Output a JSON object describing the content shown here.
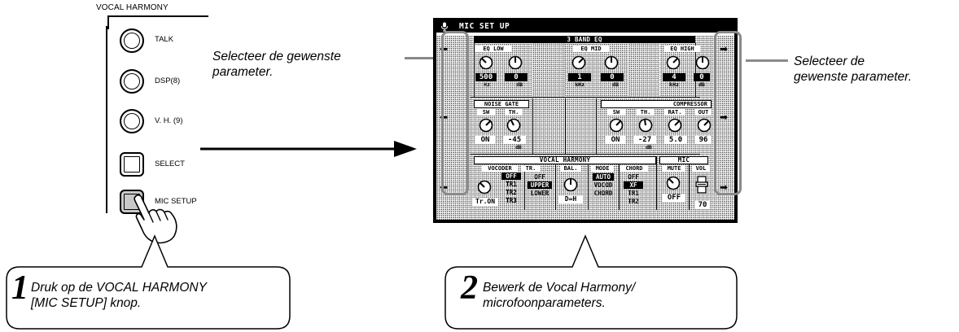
{
  "panel": {
    "title": "VOCAL HARMONY",
    "buttons": [
      {
        "label": "TALK"
      },
      {
        "label": "DSP(8)"
      },
      {
        "label": "V. H. (9)"
      },
      {
        "label": "SELECT"
      },
      {
        "label": "MIC SETUP"
      }
    ]
  },
  "annotations": {
    "left_caption": "Selecteer de gewenste parameter.",
    "left_caption_lines": [
      "Selecteer de gewenste",
      "parameter."
    ],
    "right_caption": "Selecteer de gewenste parameter.",
    "right_caption_lines": [
      "Selecteer de",
      "gewenste parameter."
    ]
  },
  "steps": [
    {
      "number": "1",
      "lines": [
        "Druk op de VOCAL HARMONY",
        "[MIC SETUP] knop."
      ]
    },
    {
      "number": "2",
      "lines": [
        "Bewerk de Vocal Harmony/",
        "microfoonparameters."
      ]
    }
  ],
  "screen": {
    "title": "MIC SET UP",
    "eq": {
      "header": "3 BAND EQ",
      "groups": [
        {
          "label": "EQ LOW",
          "freq": "500",
          "freq_unit": "Hz",
          "gain": "0",
          "gain_unit": "dB"
        },
        {
          "label": "EQ MID",
          "freq": "1",
          "freq_unit": "kHz",
          "gain": "0",
          "gain_unit": "dB"
        },
        {
          "label": "EQ HIGH",
          "freq": "4",
          "freq_unit": "kHz",
          "gain": "0",
          "gain_unit": "dB"
        }
      ]
    },
    "noise_gate": {
      "header": "NOISE GATE",
      "sw_label": "SW",
      "sw_value": "ON",
      "th_label": "TH.",
      "th_value": "-45",
      "th_unit": "dB"
    },
    "compressor": {
      "header": "COMPRESSOR",
      "sw_label": "SW",
      "sw_value": "ON",
      "th_label": "TH.",
      "th_value": "-27",
      "th_unit": "dB",
      "rat_label": "RAT.",
      "rat_value": "5.0",
      "out_label": "OUT",
      "out_value": "96"
    },
    "vocal_harmony": {
      "header": "VOCAL HARMONY",
      "vocoder_label": "VOCODER",
      "vocoder_knob_value": "Tr.ON",
      "vocoder_options": [
        "OFF",
        "TR1",
        "TR2",
        "TR3"
      ],
      "vocoder_selected": "OFF",
      "tr_label": "TR.",
      "tr_options": [
        "OFF",
        "UPPER",
        "LOWER"
      ],
      "tr_selected": "UPPER",
      "bal_label": "BAL.",
      "bal_value": "D=H",
      "mode_label": "MODE",
      "mode_options": [
        "AUTO",
        "VOCOD",
        "CHORD"
      ],
      "mode_selected": "AUTO",
      "chord_label": "CHORD",
      "chord_options": [
        "OFF",
        "XF",
        "TR1",
        "TR2"
      ],
      "chord_selected": "XF"
    },
    "mic": {
      "header": "MIC",
      "mute_label": "MUTE",
      "mute_value": "OFF",
      "vol_label": "VOL",
      "vol_value": "70"
    }
  }
}
